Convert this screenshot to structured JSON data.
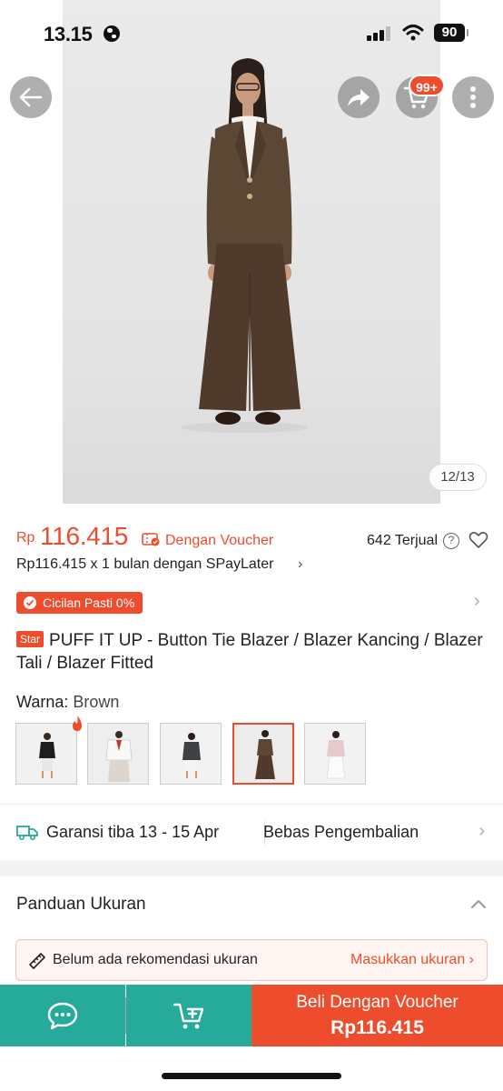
{
  "status_bar": {
    "time": "13.15",
    "battery": "90"
  },
  "hero": {
    "image_counter": "12/13",
    "cart_badge": "99+",
    "icons": [
      "back-arrow-icon",
      "share-icon",
      "cart-icon",
      "more-icon"
    ]
  },
  "price": {
    "currency": "Rp",
    "value": "116.415",
    "voucher_label": "Dengan Voucher",
    "sold": "642 Terjual",
    "help": "?",
    "paylater": "Rp116.415 x 1 bulan dengan SPayLater",
    "paylater_chevron": "›"
  },
  "cicilan": {
    "label": "Cicilan Pasti 0%",
    "chevron": "›"
  },
  "product": {
    "badge": "Star",
    "title": "PUFF IT UP - Button Tie Blazer / Blazer Kancing / Blazer Tali / Blazer Fitted"
  },
  "variant": {
    "label": "Warna:",
    "value": "Brown",
    "options": [
      {
        "name": "Black",
        "selected": false
      },
      {
        "name": "White",
        "selected": false
      },
      {
        "name": "Grey",
        "selected": false
      },
      {
        "name": "Brown",
        "selected": true
      },
      {
        "name": "Pink",
        "selected": false
      }
    ]
  },
  "shipping": {
    "garansi": "Garansi tiba 13 - 15 Apr",
    "bebas": "Bebas Pengembalian",
    "chevron": "›"
  },
  "size_guide": {
    "title": "Panduan Ukuran",
    "recommendation": "Belum ada rekomendasi ukuran",
    "link": "Masukkan ukuran ›"
  },
  "bottom_bar": {
    "buy_label": "Beli Dengan Voucher",
    "buy_price": "Rp116.415"
  },
  "colors": {
    "accent": "#ee4d2d",
    "teal": "#26aa99"
  }
}
